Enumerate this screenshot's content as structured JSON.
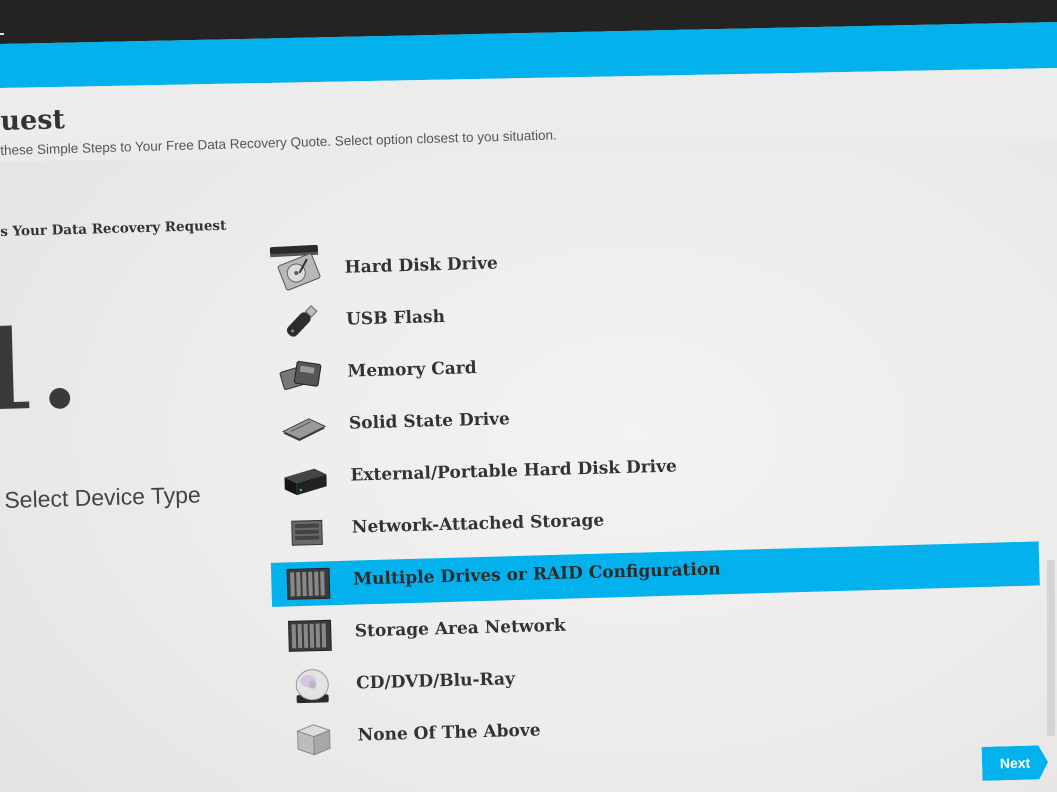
{
  "header": {
    "title": "uest",
    "subtitle": "these Simple Steps to Your Free Data Recovery Quote. Select option closest to you situation."
  },
  "section_label": "s Your Data Recovery Request",
  "step": {
    "number": "1.",
    "label": "Select Device Type"
  },
  "devices": [
    {
      "label": "Hard Disk Drive",
      "icon": "hard-disk-icon",
      "selected": false
    },
    {
      "label": "USB Flash",
      "icon": "usb-flash-icon",
      "selected": false
    },
    {
      "label": "Memory Card",
      "icon": "memory-card-icon",
      "selected": false
    },
    {
      "label": "Solid State Drive",
      "icon": "ssd-icon",
      "selected": false
    },
    {
      "label": "External/Portable Hard Disk Drive",
      "icon": "external-drive-icon",
      "selected": false
    },
    {
      "label": "Network-Attached Storage",
      "icon": "nas-icon",
      "selected": false
    },
    {
      "label": "Multiple Drives or RAID Configuration",
      "icon": "raid-icon",
      "selected": true
    },
    {
      "label": "Storage Area Network",
      "icon": "san-icon",
      "selected": false
    },
    {
      "label": "CD/DVD/Blu-Ray",
      "icon": "disc-icon",
      "selected": false
    },
    {
      "label": "None Of The Above",
      "icon": "box-icon",
      "selected": false
    }
  ],
  "next_label": "Next",
  "colors": {
    "accent": "#03b1ec",
    "topbar": "#232323",
    "text": "#333333"
  }
}
